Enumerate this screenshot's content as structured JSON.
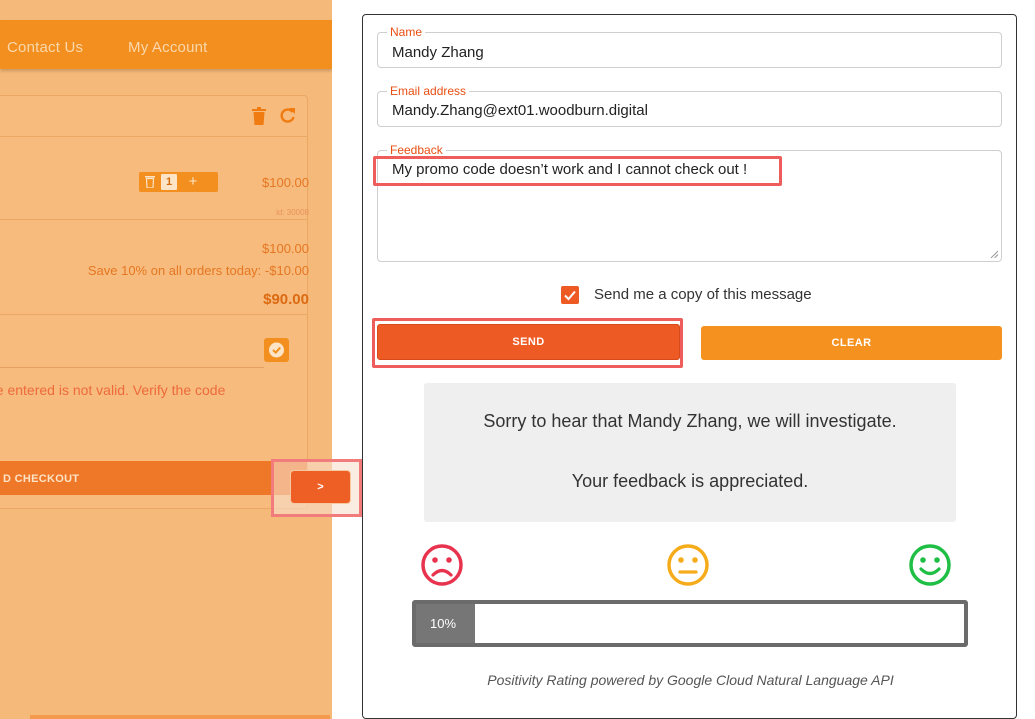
{
  "shop": {
    "nav": {
      "contact": "Contact Us",
      "account": "My Account"
    },
    "cart": {
      "quantity": "1",
      "item_price": "$100.00",
      "item_id": "id: 30008",
      "subtotal": "$100.00",
      "discount": "Save 10% on all orders today: -$10.00",
      "total": "$90.00",
      "promo_error": "ave entered is not valid. Verify the code",
      "checkout_label": "D CHECKOUT",
      "icons": [
        "trash-icon",
        "refresh-icon",
        "check-icon"
      ]
    },
    "arrow_label": ">"
  },
  "feedback_form": {
    "name": {
      "label": "Name",
      "value": "Mandy Zhang"
    },
    "email": {
      "label": "Email address",
      "value": "Mandy.Zhang@ext01.woodburn.digital"
    },
    "feedback": {
      "label": "Feedback",
      "value": "My promo code doesn’t work and I cannot check out !"
    },
    "send_copy": {
      "label": "Send me a copy of this message",
      "checked": true
    },
    "send_label": "SEND",
    "clear_label": "CLEAR",
    "result": {
      "line1": "Sorry to hear that Mandy Zhang, we will investigate.",
      "line2": "Your feedback is appreciated."
    },
    "sentiment": {
      "icons": [
        "sad-face-icon",
        "neutral-face-icon",
        "happy-face-icon"
      ],
      "rating_label": "10%",
      "rating_fraction": 0.107
    },
    "powered_by": "Positivity Rating powered by Google Cloud Natural Language API"
  },
  "colors": {
    "accent_orange": "#f5921f",
    "send_red_orange": "#ee5a24",
    "highlight_red": "#ef5c5c",
    "sad_red": "#e8334f",
    "neutral_yellow": "#f6ac1a",
    "happy_green": "#1fbf45",
    "rating_gray": "#767676"
  }
}
